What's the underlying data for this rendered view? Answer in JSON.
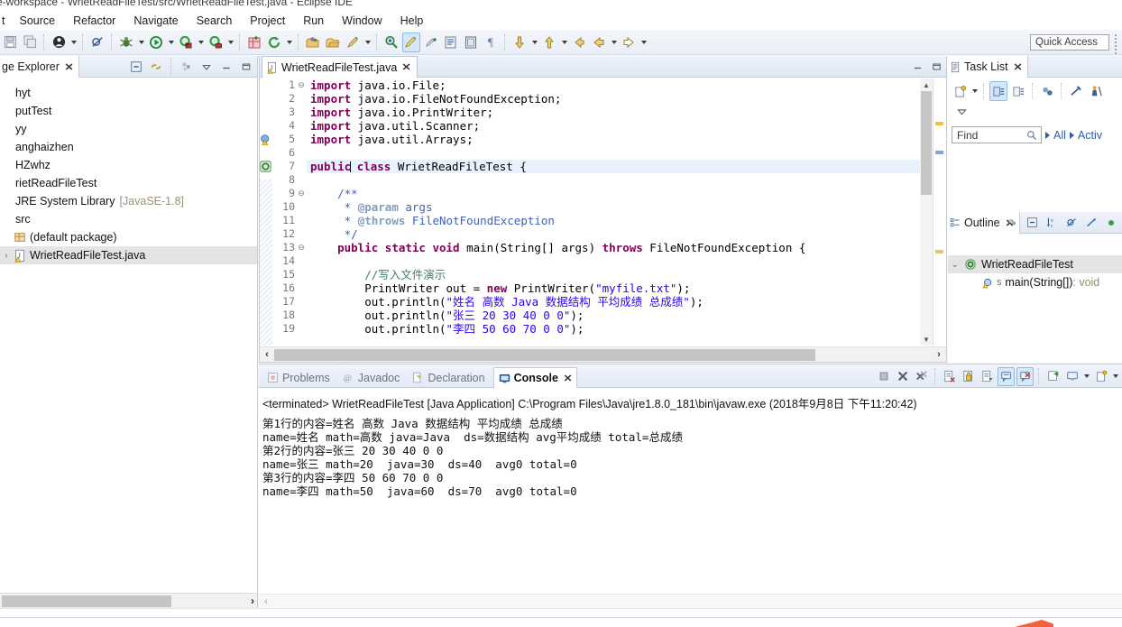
{
  "window": {
    "title": "e-workspace - WrietReadFileTest/src/WrietReadFileTest.java - Eclipse IDE"
  },
  "menubar": {
    "items": [
      {
        "label": "t"
      },
      {
        "label": "Source"
      },
      {
        "label": "Refactor"
      },
      {
        "label": "Navigate"
      },
      {
        "label": "Search"
      },
      {
        "label": "Project"
      },
      {
        "label": "Run"
      },
      {
        "label": "Window"
      },
      {
        "label": "Help"
      }
    ]
  },
  "toolbar": {
    "quick_access": "Quick Access",
    "icons": [
      "save-icon",
      "save-all-icon",
      "skip-breakpoints-icon",
      "debug-icon",
      "run-icon",
      "run-as-coverage-icon",
      "external-tools-icon",
      "new-java-project-icon",
      "refresh-icon",
      "open-type-icon",
      "open-task-icon",
      "search-icon",
      "next-annotation-icon",
      "previous-annotation-icon",
      "last-edit-location-icon",
      "back-icon",
      "forward-icon"
    ]
  },
  "package_explorer": {
    "tab_label": "ge Explorer",
    "tab_close": "✕",
    "toolbar_icons": [
      "collapse-all-icon",
      "link-with-editor-icon",
      "view-menu-icon",
      "minimize-icon",
      "maximize-icon"
    ],
    "tree": [
      {
        "label": "hyt",
        "icon": "project-icon",
        "indent": 0,
        "twisty": "",
        "selected": false
      },
      {
        "label": "putTest",
        "icon": "project-icon",
        "indent": 0,
        "twisty": "",
        "selected": false
      },
      {
        "label": "yy",
        "icon": "project-icon",
        "indent": 0,
        "twisty": "",
        "selected": false
      },
      {
        "label": "anghaizhen",
        "icon": "project-icon",
        "indent": 0,
        "twisty": "",
        "selected": false
      },
      {
        "label": "HZwhz",
        "icon": "project-icon",
        "indent": 0,
        "twisty": "",
        "selected": false
      },
      {
        "label": "rietReadFileTest",
        "icon": "project-icon",
        "indent": 0,
        "twisty": "",
        "selected": false
      },
      {
        "label": "JRE System Library",
        "suffix": "[JavaSE-1.8]",
        "icon": "library-icon",
        "indent": 1,
        "twisty": "",
        "selected": false
      },
      {
        "label": "src",
        "icon": "source-folder-icon",
        "indent": 1,
        "twisty": "",
        "selected": false
      },
      {
        "label": "(default package)",
        "icon": "package-icon",
        "indent": 2,
        "twisty": "",
        "selected": false
      },
      {
        "label": "WrietReadFileTest.java",
        "icon": "java-file-icon",
        "indent": 3,
        "twisty": "›",
        "selected": true
      }
    ]
  },
  "editor": {
    "tab_label": "WrietReadFileTest.java",
    "tab_close": "✕",
    "tab_icon": "java-file-warning-icon",
    "highlighted_line": 7,
    "lines": [
      {
        "n": "1",
        "fold": "⊖",
        "marker": "",
        "tokens": [
          {
            "t": "kw",
            "v": "import"
          },
          {
            "t": "p",
            "v": " java.io.File;"
          }
        ]
      },
      {
        "n": "2",
        "fold": "",
        "marker": "",
        "tokens": [
          {
            "t": "kw",
            "v": "import"
          },
          {
            "t": "p",
            "v": " java.io.FileNotFoundException;"
          }
        ]
      },
      {
        "n": "3",
        "fold": "",
        "marker": "",
        "tokens": [
          {
            "t": "kw",
            "v": "import"
          },
          {
            "t": "p",
            "v": " java.io.PrintWriter;"
          }
        ]
      },
      {
        "n": "4",
        "fold": "",
        "marker": "",
        "tokens": [
          {
            "t": "kw",
            "v": "import"
          },
          {
            "t": "p",
            "v": " java.util.Scanner;"
          }
        ]
      },
      {
        "n": "5",
        "fold": "",
        "marker": "warning-icon",
        "tokens": [
          {
            "t": "kw",
            "v": "import"
          },
          {
            "t": "p",
            "v": " java.util.Arrays;"
          }
        ]
      },
      {
        "n": "6",
        "fold": "",
        "marker": "",
        "tokens": []
      },
      {
        "n": "7",
        "fold": "",
        "marker": "class-marker-icon",
        "tokens": [
          {
            "t": "kw",
            "v": "public"
          },
          {
            "t": "caret",
            "v": ""
          },
          {
            "t": "p",
            "v": " "
          },
          {
            "t": "kw",
            "v": "class"
          },
          {
            "t": "p",
            "v": " WrietReadFileTest {"
          }
        ]
      },
      {
        "n": "8",
        "fold": "",
        "marker": "",
        "tokens": []
      },
      {
        "n": "9",
        "fold": "⊖",
        "marker": "",
        "tokens": [
          {
            "t": "p",
            "v": "    "
          },
          {
            "t": "jdoc",
            "v": "/**"
          }
        ]
      },
      {
        "n": "10",
        "fold": "",
        "marker": "",
        "tokens": [
          {
            "t": "p",
            "v": "     "
          },
          {
            "t": "jdoc",
            "v": "* "
          },
          {
            "t": "jdoc-tag",
            "v": "@param"
          },
          {
            "t": "jdoc",
            "v": " args"
          }
        ]
      },
      {
        "n": "11",
        "fold": "",
        "marker": "",
        "tokens": [
          {
            "t": "p",
            "v": "     "
          },
          {
            "t": "jdoc",
            "v": "* "
          },
          {
            "t": "jdoc-tag",
            "v": "@throws"
          },
          {
            "t": "jdoc",
            "v": " FileNotFoundException"
          }
        ]
      },
      {
        "n": "12",
        "fold": "",
        "marker": "",
        "tokens": [
          {
            "t": "p",
            "v": "     "
          },
          {
            "t": "jdoc",
            "v": "*/"
          }
        ]
      },
      {
        "n": "13",
        "fold": "⊖",
        "marker": "",
        "tokens": [
          {
            "t": "p",
            "v": "    "
          },
          {
            "t": "kw",
            "v": "public static void"
          },
          {
            "t": "p",
            "v": " main(String[] args) "
          },
          {
            "t": "kw",
            "v": "throws"
          },
          {
            "t": "p",
            "v": " FileNotFoundException {"
          }
        ]
      },
      {
        "n": "14",
        "fold": "",
        "marker": "",
        "tokens": []
      },
      {
        "n": "15",
        "fold": "",
        "marker": "",
        "tokens": [
          {
            "t": "p",
            "v": "        "
          },
          {
            "t": "cmt",
            "v": "//写入文件演示"
          }
        ]
      },
      {
        "n": "16",
        "fold": "",
        "marker": "",
        "tokens": [
          {
            "t": "p",
            "v": "        PrintWriter out = "
          },
          {
            "t": "kw",
            "v": "new"
          },
          {
            "t": "p",
            "v": " PrintWriter("
          },
          {
            "t": "str",
            "v": "\"myfile.txt\""
          },
          {
            "t": "p",
            "v": ");"
          }
        ]
      },
      {
        "n": "17",
        "fold": "",
        "marker": "",
        "tokens": [
          {
            "t": "p",
            "v": "        out.println("
          },
          {
            "t": "str",
            "v": "\"姓名 高数 Java 数据结构 平均成绩 总成绩\""
          },
          {
            "t": "p",
            "v": ");"
          }
        ]
      },
      {
        "n": "18",
        "fold": "",
        "marker": "",
        "tokens": [
          {
            "t": "p",
            "v": "        out.println("
          },
          {
            "t": "str",
            "v": "\"张三 20 30 40 0 0\""
          },
          {
            "t": "p",
            "v": ");"
          }
        ]
      },
      {
        "n": "19",
        "fold": "",
        "marker": "",
        "tokens": [
          {
            "t": "p",
            "v": "        out.println("
          },
          {
            "t": "str",
            "v": "\"李四 50 60 70 0 0\""
          },
          {
            "t": "p",
            "v": ");"
          }
        ]
      }
    ]
  },
  "task_list": {
    "tab_label": "Task List",
    "tab_close": "✕",
    "tab_icon": "task-list-icon",
    "toolbar_icons": [
      "new-task-icon",
      "view-menu-arrow-icon",
      "categorized-icon",
      "scheduled-icon",
      "synchronize-icon",
      "focus-icon",
      "activate-icon"
    ],
    "find_placeholder": "Find",
    "find_value": "",
    "filters": [
      "All",
      "Activ"
    ]
  },
  "outline": {
    "tab_label": "Outline",
    "tab_close": "✕",
    "tab_icon": "outline-icon",
    "toolbar_icons": [
      "focus-icon",
      "collapse-all-icon",
      "sort-icon",
      "hide-fields-icon",
      "hide-static-icon",
      "hide-nonpublic-icon"
    ],
    "items": [
      {
        "label": "WrietReadFileTest",
        "icon": "class-icon",
        "indent": 0,
        "twisty": "⌄",
        "selected": true,
        "suffix": ""
      },
      {
        "label": "main(String[])",
        "icon": "method-static-icon",
        "indent": 1,
        "twisty": "",
        "selected": false,
        "suffix": " : void"
      }
    ]
  },
  "console_panel": {
    "tabs": [
      {
        "label": "Problems",
        "icon": "problems-icon",
        "active": false
      },
      {
        "label": "Javadoc",
        "icon": "javadoc-icon",
        "active": false
      },
      {
        "label": "Declaration",
        "icon": "declaration-icon",
        "active": false
      },
      {
        "label": "Console",
        "icon": "console-icon",
        "active": true
      }
    ],
    "tab_close": "✕",
    "toolbar_icons": [
      "terminate-icon",
      "remove-launch-icon",
      "remove-all-terminated-icon",
      "clear-console-icon",
      "scroll-lock-icon",
      "word-wrap-icon",
      "show-console-on-output-icon",
      "show-console-on-error-icon",
      "pin-console-icon",
      "display-selected-console-icon",
      "open-console-icon"
    ],
    "header": "<terminated> WrietReadFileTest [Java Application] C:\\Program Files\\Java\\jre1.8.0_181\\bin\\javaw.exe (2018年9月8日 下午11:20:42)",
    "output": [
      "第1行的内容=姓名 高数 Java 数据结构 平均成绩 总成绩",
      "name=姓名 math=高数 java=Java  ds=数据结构 avg平均成绩 total=总成绩",
      "第2行的内容=张三 20 30 40 0 0",
      "name=张三 math=20  java=30  ds=40  avg0 total=0",
      "第3行的内容=李四 50 60 70 0 0",
      "name=李四 math=50  java=60  ds=70  avg0 total=0"
    ]
  },
  "scrollbars": {
    "left_arrow": "›",
    "console_left_arrow": "‹"
  }
}
